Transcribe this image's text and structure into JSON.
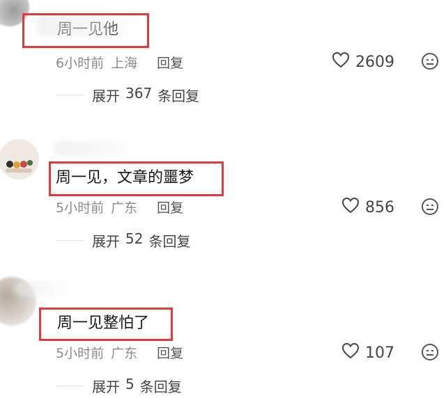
{
  "comments": [
    {
      "text": "周一见他",
      "time": "6小时前",
      "location": "上海",
      "reply_label": "回复",
      "likes": "2609",
      "expand_prefix": "展开",
      "expand_count": "367",
      "expand_suffix": "条回复"
    },
    {
      "text": "周一见，文章的噩梦",
      "time": "5小时前",
      "location": "广东",
      "reply_label": "回复",
      "likes": "856",
      "expand_prefix": "展开",
      "expand_count": "52",
      "expand_suffix": "条回复"
    },
    {
      "text": "周一见整怕了",
      "time": "5小时前",
      "location": "广东",
      "reply_label": "回复",
      "likes": "107",
      "expand_prefix": "展开",
      "expand_count": "5",
      "expand_suffix": "条回复"
    }
  ],
  "colors": {
    "highlight": "#e0393e",
    "meta": "#8a8a8a"
  },
  "icons": {
    "like": "heart-outline-icon",
    "emoji": "neutral-face-icon"
  }
}
